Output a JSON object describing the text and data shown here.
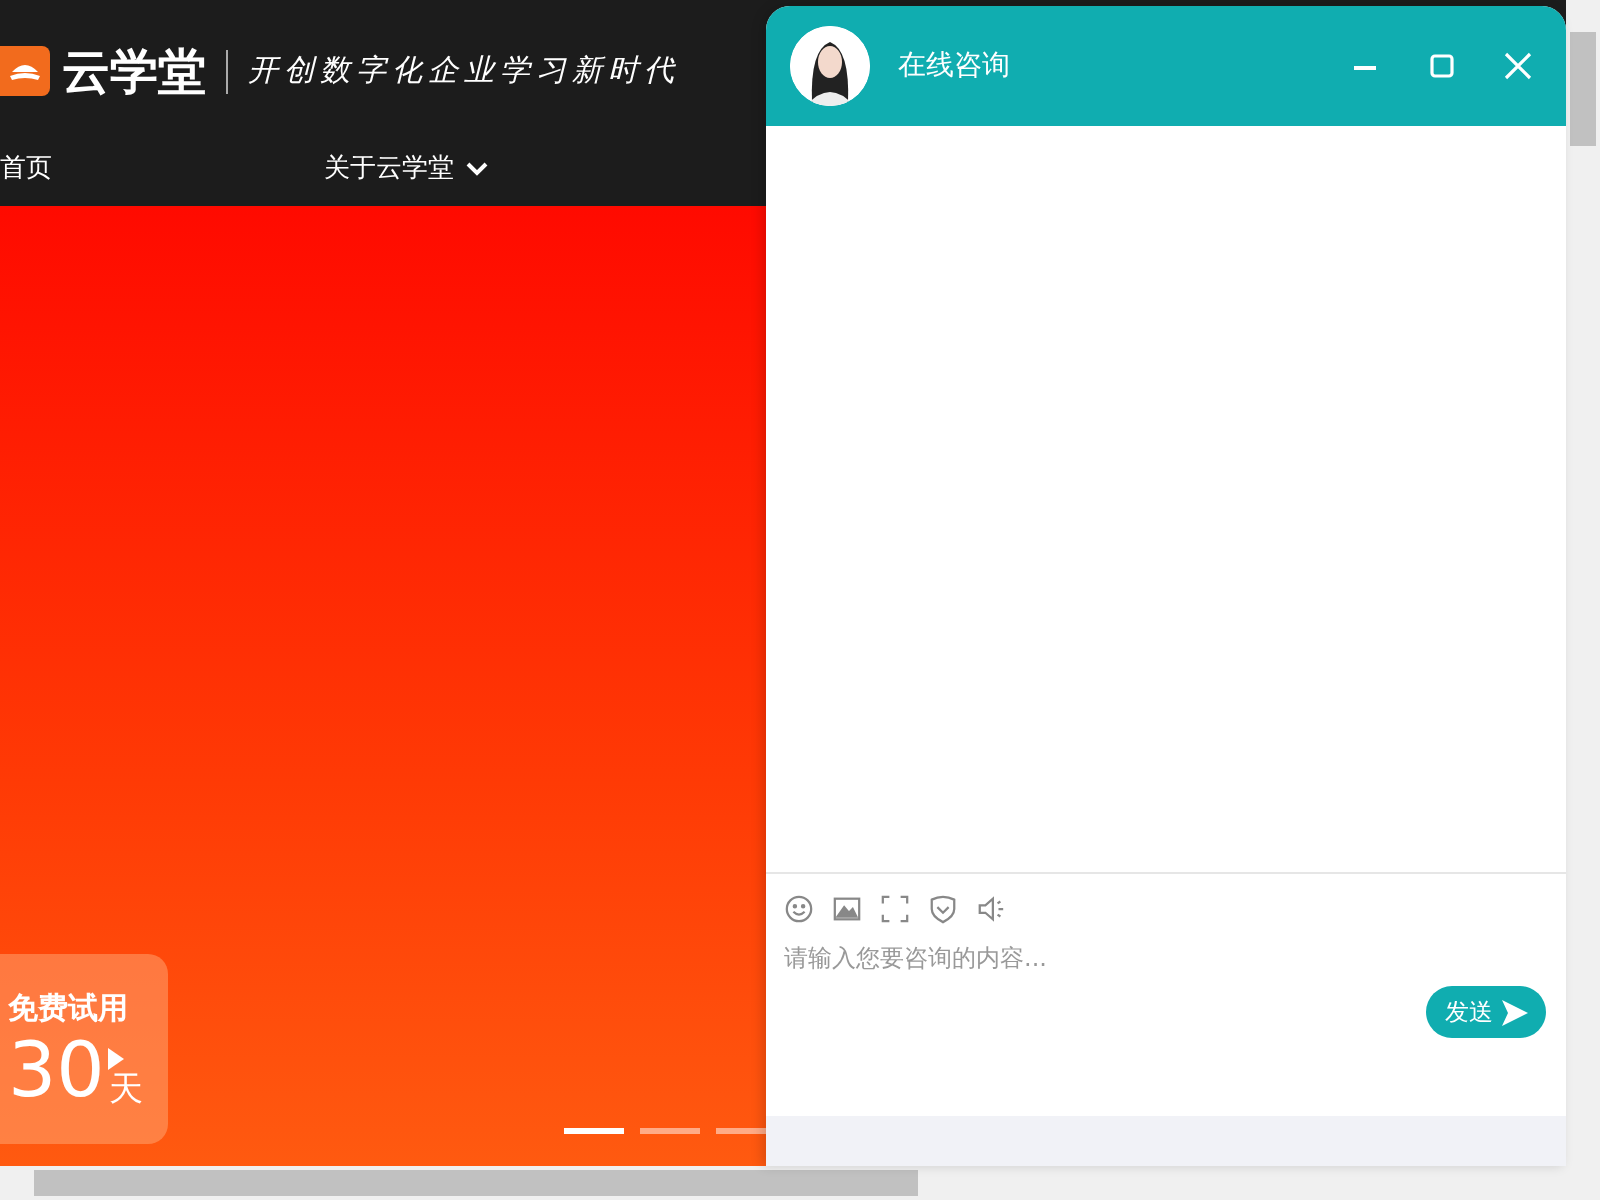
{
  "header": {
    "brand": "云学堂",
    "slogan": "开创数字化企业学习新时代"
  },
  "nav": {
    "items": [
      {
        "label": "首页",
        "dropdown": false
      },
      {
        "label": "关于云学堂",
        "dropdown": true
      }
    ]
  },
  "banner": {
    "trial": {
      "label": "免费试用",
      "number": "30",
      "unit": "天"
    },
    "dots": [
      {
        "selected": true
      },
      {
        "selected": false
      },
      {
        "selected": false
      }
    ]
  },
  "chat": {
    "title": "在线咨询",
    "input": {
      "placeholder": "请输入您要咨询的内容..."
    },
    "send": "发送"
  }
}
